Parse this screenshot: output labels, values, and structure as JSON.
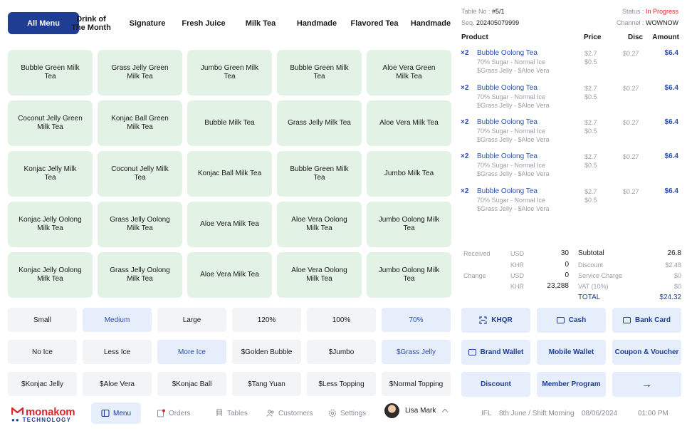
{
  "categories": [
    {
      "label": "All Menu",
      "active": true
    },
    {
      "label": "Drink of The Month",
      "active": false
    },
    {
      "label": "Signature",
      "active": false
    },
    {
      "label": "Fresh Juice",
      "active": false
    },
    {
      "label": "Milk Tea",
      "active": false
    },
    {
      "label": "Handmade",
      "active": false
    },
    {
      "label": "Flavored Tea",
      "active": false
    },
    {
      "label": "Handmade",
      "active": false
    }
  ],
  "products": [
    "Bubble Green Milk Tea",
    "Grass Jelly Green Milk Tea",
    "Jumbo Green Milk Tea",
    "Bubble Green Milk Tea",
    "Aloe Vera Green Milk Tea",
    "Coconut Jelly Green Milk Tea",
    "Konjac Ball Green Milk Tea",
    "Bubble Milk Tea",
    "Grass Jelly Milk Tea",
    "Aloe Vera Milk Tea",
    "Konjac Jelly Milk Tea",
    "Coconut Jelly Milk Tea",
    "Konjac Ball Milk Tea",
    "Bubble Green Milk Tea",
    "Jumbo Milk Tea",
    "Konjac Jelly Oolong Milk Tea",
    "Grass Jelly Oolong Milk Tea",
    "Aloe Vera Milk Tea",
    "Aloe Vera Oolong Milk Tea",
    "Jumbo Oolong Milk Tea",
    "Konjac Jelly Oolong Milk Tea",
    "Grass Jelly Oolong Milk Tea",
    "Aloe Vera Milk Tea",
    "Aloe Vera Oolong Milk Tea",
    "Jumbo Oolong Milk Tea"
  ],
  "options": [
    {
      "label": "Small",
      "selected": false
    },
    {
      "label": "Medium",
      "selected": true
    },
    {
      "label": "Large",
      "selected": false
    },
    {
      "label": "120%",
      "selected": false
    },
    {
      "label": "100%",
      "selected": false
    },
    {
      "label": "70%",
      "selected": true
    },
    {
      "label": "No Ice",
      "selected": false
    },
    {
      "label": "Less Ice",
      "selected": false
    },
    {
      "label": "More Ice",
      "selected": true
    },
    {
      "label": "$Golden Bubble",
      "selected": false
    },
    {
      "label": "$Jumbo",
      "selected": false
    },
    {
      "label": "$Grass Jelly",
      "selected": true
    },
    {
      "label": "$Konjac Jelly",
      "selected": false
    },
    {
      "label": "$Aloe Vera",
      "selected": false
    },
    {
      "label": "$Konjac Ball",
      "selected": false
    },
    {
      "label": "$Tang Yuan",
      "selected": false
    },
    {
      "label": "$Less Topping",
      "selected": false
    },
    {
      "label": "$Normal Topping",
      "selected": false
    }
  ],
  "logo": {
    "brand": "monakom",
    "tagline": "TECHNOLOGY"
  },
  "nav": {
    "menu": "Menu",
    "orders": "Orders",
    "tables": "Tables",
    "customers": "Customers",
    "settings": "Settings",
    "user": "Lisa Mark"
  },
  "footer": {
    "code": "IFL",
    "shift": "8th June / Shift Morning",
    "date": "08/06/2024",
    "time": "01:00 PM"
  },
  "order": {
    "table_label": "Table No :",
    "table_value": "#5/1",
    "status_label": "Status :",
    "status_value": "In Progress",
    "seq_label": "Seq.",
    "seq_value": "202405079999",
    "channel_label": "Channel :",
    "channel_value": "WOWNOW",
    "columns": {
      "product": "Product",
      "price": "Price",
      "disc": "Disc",
      "amount": "Amount"
    },
    "items": [
      {
        "qty": "×2",
        "name": "Bubble Oolong Tea",
        "mod1": "70% Sugar - Normal Ice",
        "mod2": "$Grass Jelly - $Aloe Vera",
        "price1": "$2.7",
        "price2": "$0.5",
        "disc": "$0.27",
        "amount": "$6.4"
      },
      {
        "qty": "×2",
        "name": "Bubble Oolong Tea",
        "mod1": "70% Sugar - Normal Ice",
        "mod2": "$Grass Jelly - $Aloe Vera",
        "price1": "$2.7",
        "price2": "$0.5",
        "disc": "$0.27",
        "amount": "$6.4"
      },
      {
        "qty": "×2",
        "name": "Bubble Oolong Tea",
        "mod1": "70% Sugar - Normal Ice",
        "mod2": "$Grass Jelly - $Aloe Vera",
        "price1": "$2.7",
        "price2": "$0.5",
        "disc": "$0.27",
        "amount": "$6.4"
      },
      {
        "qty": "×2",
        "name": "Bubble Oolong Tea",
        "mod1": "70% Sugar - Normal Ice",
        "mod2": "$Grass Jelly - $Aloe Vera",
        "price1": "$2.7",
        "price2": "$0.5",
        "disc": "$0.27",
        "amount": "$6.4"
      },
      {
        "qty": "×2",
        "name": "Bubble Oolong Tea",
        "mod1": "70% Sugar - Normal Ice",
        "mod2": "$Grass Jelly - $Aloe Vera",
        "price1": "$2.7",
        "price2": "$0.5",
        "disc": "$0.27",
        "amount": "$6.4"
      }
    ]
  },
  "payment_summary": {
    "received_label": "Received",
    "change_label": "Change",
    "usd": "USD",
    "khr": "KHR",
    "received_usd": "30",
    "received_khr": "0",
    "change_usd": "0",
    "change_khr": "23,288",
    "subtotal_label": "Subtotal",
    "subtotal": "26.8",
    "discount_label": "Discount",
    "discount": "$2.48",
    "service_label": "Service Charge",
    "service": "$0",
    "vat_label": "VAT (10%)",
    "vat": "$0",
    "total_label": "TOTAL",
    "total": "$24.32"
  },
  "pay_buttons": {
    "khqr": "KHQR",
    "cash": "Cash",
    "bank_card": "Bank Card",
    "brand_wallet": "Brand Wallet",
    "mobile_wallet": "Mobile Wallet",
    "coupon": "Coupon & Voucher",
    "discount": "Discount",
    "member": "Member Program",
    "next": "→"
  },
  "colors": {
    "primary": "#1f3d93",
    "tile": "#e2f2e4",
    "option_selected": "#e6edfb",
    "status": "#e02626",
    "brand": "#d7262d"
  }
}
